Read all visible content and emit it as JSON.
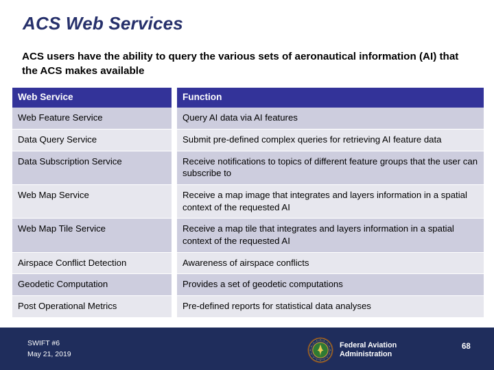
{
  "slide": {
    "title": "ACS Web Services",
    "lead": "ACS users have the ability to query the various sets of aeronautical information (AI) that the ACS makes available",
    "accent_color": "#333399",
    "title_color": "#26306b",
    "footer_color": "#1f2d5c",
    "row_shade_color": "#cdcdde",
    "row_light_color": "#e7e7ee"
  },
  "table": {
    "headers": [
      "Web Service",
      "Function"
    ],
    "rows": [
      {
        "service": "Web Feature Service",
        "function": "Query AI data via AI features"
      },
      {
        "service": "Data Query Service",
        "function": "Submit pre-defined complex queries for retrieving AI feature data"
      },
      {
        "service": "Data Subscription Service",
        "function": "Receive notifications to topics of different feature groups that the user can subscribe to"
      },
      {
        "service": "Web Map Service",
        "function": "Receive a map image that integrates and layers information in a spatial context of the requested AI"
      },
      {
        "service": "Web Map Tile Service",
        "function": "Receive a map tile that integrates and layers information in a spatial context of the requested AI"
      },
      {
        "service": "Airspace Conflict Detection",
        "function": "Awareness of airspace conflicts"
      },
      {
        "service": "Geodetic Computation",
        "function": "Provides a set of geodetic computations"
      },
      {
        "service": "Post Operational Metrics",
        "function": "Pre-defined reports for statistical data analyses"
      }
    ]
  },
  "footer": {
    "event": "SWIFT #6",
    "date": "May 21, 2019",
    "org_line1": "Federal Aviation",
    "org_line2": "Administration",
    "page_number": "68",
    "seal_icon": "faa-seal-icon"
  }
}
